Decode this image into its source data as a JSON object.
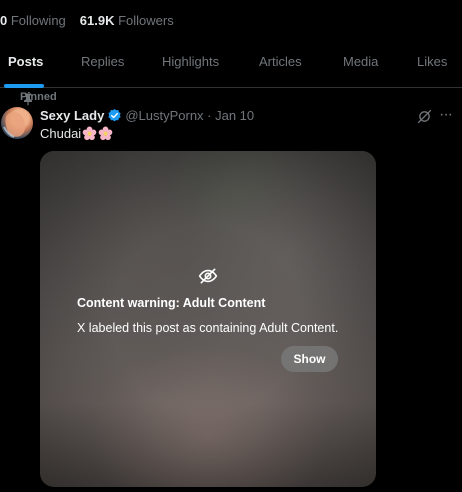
{
  "profile": {
    "following_count": "0",
    "following_label": "Following",
    "followers_count": "61.9K",
    "followers_label": "Followers"
  },
  "tabs": [
    {
      "label": "Posts",
      "active": true
    },
    {
      "label": "Replies"
    },
    {
      "label": "Highlights"
    },
    {
      "label": "Articles"
    },
    {
      "label": "Media"
    },
    {
      "label": "Likes"
    }
  ],
  "post": {
    "pinned_label": "Pinned",
    "author_name": "Sexy Lady",
    "handle_date": "@LustyPornx · Jan 10",
    "text": "Chudai",
    "emoji": [
      "cherry-blossom-icon",
      "cherry-blossom-icon"
    ],
    "content_warning": {
      "title": "Content warning: Adult Content",
      "body": "X labeled this post as containing Adult Content.",
      "show_label": "Show"
    }
  },
  "colors": {
    "accent": "#1d9bf0",
    "text": "#e7e9ea",
    "muted": "#71767b",
    "background": "#000000"
  }
}
